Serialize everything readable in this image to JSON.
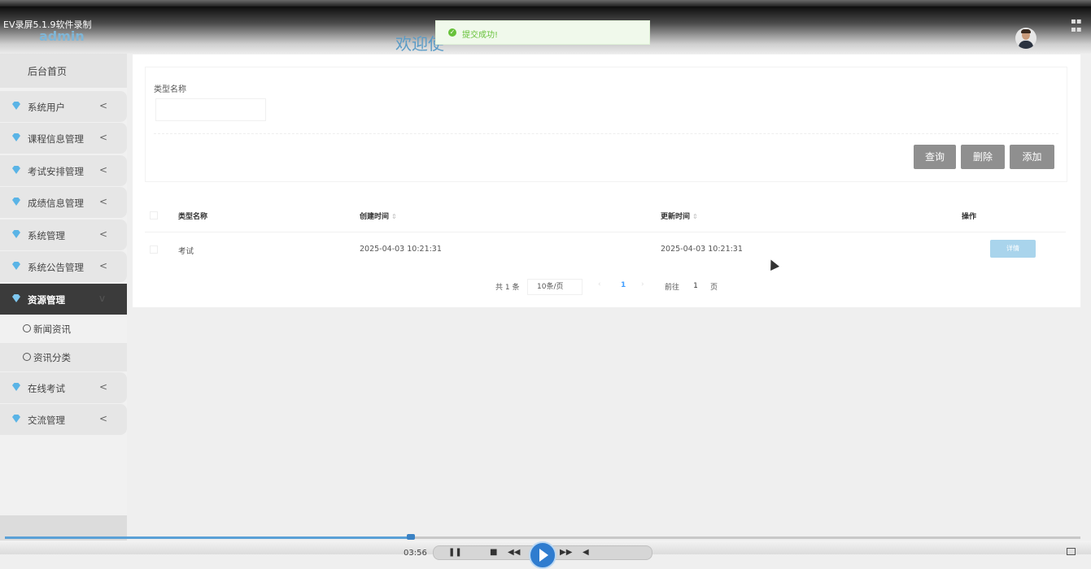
{
  "recorder": {
    "title": "EV录屏5.1.9软件录制",
    "time": "03:56"
  },
  "header": {
    "user": "admin",
    "welcome": "欢迎使"
  },
  "toast": {
    "message": "提交成功!"
  },
  "sidebar": {
    "home": "后台首页",
    "items": [
      {
        "label": "系统用户",
        "arrow": "<"
      },
      {
        "label": "课程信息管理",
        "arrow": "<"
      },
      {
        "label": "考试安排管理",
        "arrow": "<"
      },
      {
        "label": "成绩信息管理",
        "arrow": "<"
      },
      {
        "label": "系统管理",
        "arrow": "<"
      },
      {
        "label": "系统公告管理",
        "arrow": "<"
      },
      {
        "label": "资源管理",
        "arrow": "v"
      },
      {
        "label": "在线考试",
        "arrow": "<"
      },
      {
        "label": "交流管理",
        "arrow": "<"
      }
    ],
    "subitems": [
      {
        "label": "新闻资讯"
      },
      {
        "label": "资讯分类"
      }
    ]
  },
  "search": {
    "label": "类型名称",
    "value": ""
  },
  "buttons": {
    "query": "查询",
    "delete": "删除",
    "add": "添加"
  },
  "table": {
    "headers": {
      "name": "类型名称",
      "created": "创建时间",
      "updated": "更新时间",
      "action": "操作"
    },
    "rows": [
      {
        "name": "考试",
        "created": "2025-04-03 10:21:31",
        "updated": "2025-04-03 10:21:31",
        "action": "详情"
      }
    ]
  },
  "pagination": {
    "total": "共 1 条",
    "page_size": "10条/页",
    "current": "1",
    "goto": "前往",
    "goto_value": "1",
    "page_unit": "页"
  },
  "player": {
    "progress": 0.375
  },
  "colors": {
    "accent": "#409eff",
    "success": "#67c23a",
    "sidebar_active": "#3b3b3b",
    "button": "#8f8f8f",
    "gem": "#5ab4e6"
  }
}
